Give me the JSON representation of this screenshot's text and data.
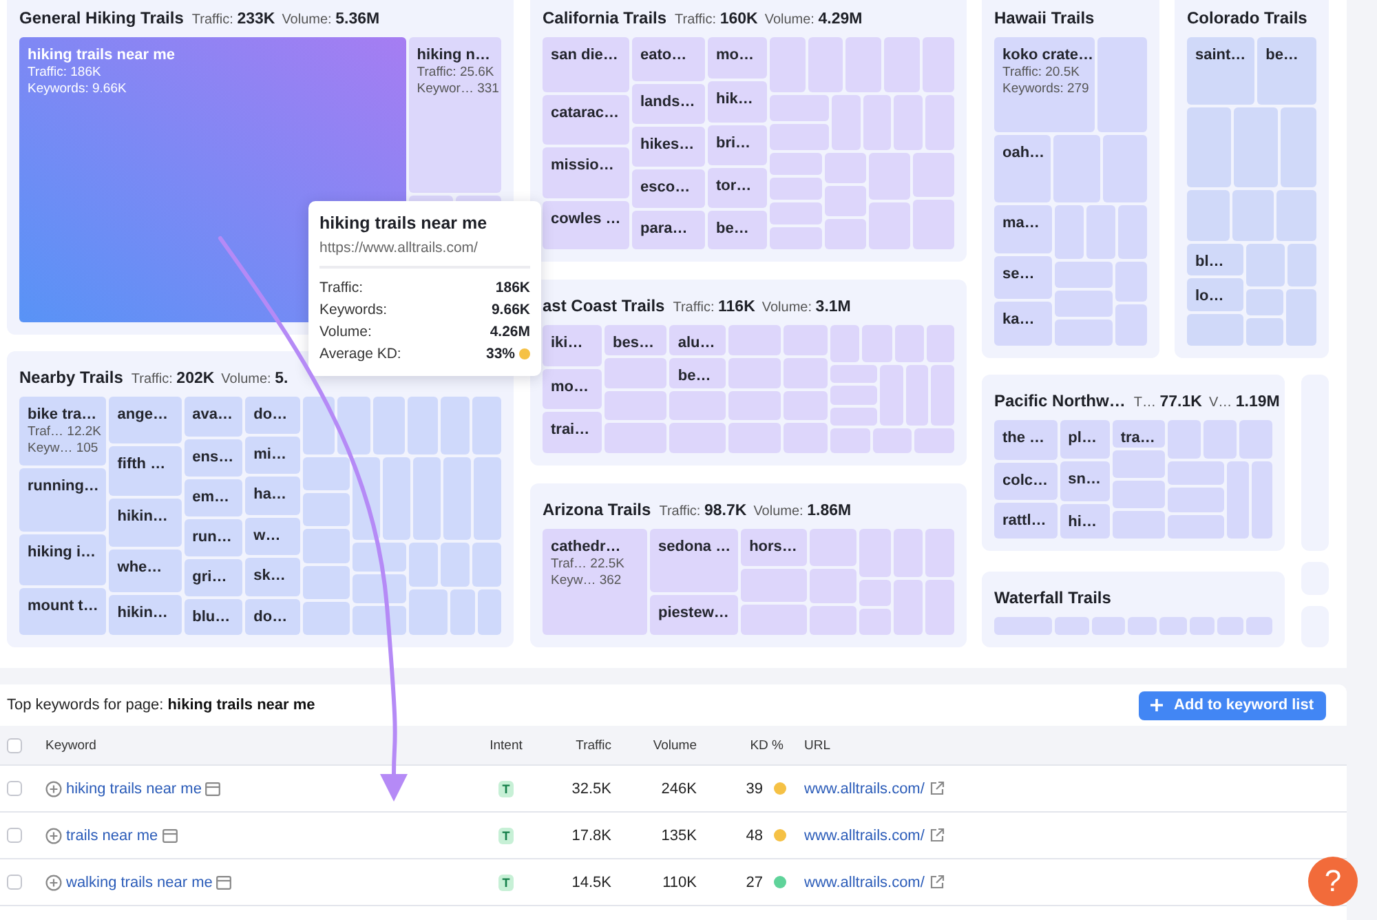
{
  "groups": [
    {
      "title": "General Hiking Trails",
      "traffic": "Traffic: **233K**",
      "volume": "Volume: **5.36M**",
      "tiles": [
        {
          "label": "hiking trails near me",
          "stats": [
            "Traffic: 186K",
            "Keywords: 9.66K"
          ],
          "selected": true
        },
        {
          "label": "hiking n…",
          "stats": [
            "Traffic: 25.6K",
            "Keywor… 331"
          ],
          "selected": false
        }
      ]
    },
    {
      "title": "Nearby Trails",
      "traffic": "Traffic: **202K**",
      "volume": "Volume: **5.**",
      "tiles": [
        {
          "label": "bike tra…",
          "stats": [
            "Traf… 12.2K",
            "Keyw… 105"
          ],
          "selected": false
        },
        {
          "label": "running…",
          "selected": false
        },
        {
          "label": "hiking i…",
          "selected": false
        },
        {
          "label": "mount t…",
          "selected": false
        },
        {
          "label": "ange…",
          "selected": false
        },
        {
          "label": "fifth …",
          "selected": false
        },
        {
          "label": "hikin…",
          "selected": false
        },
        {
          "label": "whe…",
          "selected": false
        },
        {
          "label": "hikin…",
          "selected": false
        },
        {
          "label": "ava…",
          "selected": false
        },
        {
          "label": "ens…",
          "selected": false
        },
        {
          "label": "em…",
          "selected": false
        },
        {
          "label": "run…",
          "selected": false
        },
        {
          "label": "gri…",
          "selected": false
        },
        {
          "label": "blu…",
          "selected": false
        },
        {
          "label": "do…",
          "selected": false
        },
        {
          "label": "mi…",
          "selected": false
        },
        {
          "label": "ha…",
          "selected": false
        },
        {
          "label": "w…",
          "selected": false
        },
        {
          "label": "sk…",
          "selected": false
        },
        {
          "label": "do…",
          "selected": false
        }
      ]
    },
    {
      "title": "California Trails",
      "traffic": "Traffic: **160K**",
      "volume": "Volume: **4.29M**",
      "tiles": [
        {
          "label": "san die…",
          "selected": false
        },
        {
          "label": "catarac…",
          "selected": false
        },
        {
          "label": "missio…",
          "selected": false
        },
        {
          "label": "cowles …",
          "selected": false
        },
        {
          "label": "eato…",
          "selected": false
        },
        {
          "label": "lands…",
          "selected": false
        },
        {
          "label": "hikes…",
          "selected": false
        },
        {
          "label": "esco…",
          "selected": false
        },
        {
          "label": "para…",
          "selected": false
        },
        {
          "label": "mo…",
          "selected": false
        },
        {
          "label": "hik…",
          "selected": false
        },
        {
          "label": "bri…",
          "selected": false
        },
        {
          "label": "tor…",
          "selected": false
        },
        {
          "label": "be…",
          "selected": false
        }
      ]
    },
    {
      "title": "ast Coast Trails",
      "traffic": "Traffic: **116K**",
      "volume": "Volume: **3.1M**",
      "tiles": [
        {
          "label": "iki…",
          "selected": false
        },
        {
          "label": "mo…",
          "selected": false
        },
        {
          "label": "trai…",
          "selected": false
        },
        {
          "label": "bes…",
          "selected": false
        },
        {
          "label": "alu…",
          "selected": false
        },
        {
          "label": "be…",
          "selected": false
        }
      ]
    },
    {
      "title": "Arizona Trails",
      "traffic": "Traffic: **98.7K**",
      "volume": "Volume: **1.86M**",
      "tiles": [
        {
          "label": "cathedr…",
          "stats": [
            "Traf… 22.5K",
            "Keyw… 362"
          ],
          "selected": false
        },
        {
          "label": "sedona …",
          "selected": false
        },
        {
          "label": "piestew…",
          "selected": false
        },
        {
          "label": "hors…",
          "selected": false
        }
      ]
    },
    {
      "title": "Hawaii Trails",
      "tiles": [
        {
          "label": "koko crate…",
          "stats": [
            "Traffic: 20.5K",
            "Keywords: 279"
          ],
          "selected": false
        },
        {
          "label": "oah…",
          "selected": false
        },
        {
          "label": "ma…",
          "selected": false
        },
        {
          "label": "se…",
          "selected": false
        },
        {
          "label": "ka…",
          "selected": false
        }
      ]
    },
    {
      "title": "Colorado Trails",
      "tiles": [
        {
          "label": "saint…",
          "selected": false
        },
        {
          "label": "be…",
          "selected": false
        },
        {
          "label": "bl…",
          "selected": false
        },
        {
          "label": "lo…",
          "selected": false
        }
      ]
    },
    {
      "title": "Pacific Northw…",
      "traffic": "T… **77.1K**",
      "volume": "V… **1.19M**",
      "tiles": [
        {
          "label": "the …",
          "selected": false
        },
        {
          "label": "colc…",
          "selected": false
        },
        {
          "label": "rattl…",
          "selected": false
        },
        {
          "label": "pl…",
          "selected": false
        },
        {
          "label": "sn…",
          "selected": false
        },
        {
          "label": "hi…",
          "selected": false
        },
        {
          "label": "tra…",
          "selected": false
        }
      ]
    },
    {
      "title": "Waterfall Trails"
    }
  ],
  "tooltip": {
    "title": "hiking trails near me",
    "url": "https://www.alltrails.com/",
    "rows": [
      {
        "label": "Traffic:",
        "value": "186K"
      },
      {
        "label": "Keywords:",
        "value": "9.66K"
      },
      {
        "label": "Volume:",
        "value": "4.26M"
      },
      {
        "label": "Average KD:",
        "value": "33%",
        "color": "#f5c145"
      }
    ]
  },
  "table": {
    "caption": "Top keywords for page: **hiking trails near me**",
    "button": "Add to keyword list",
    "select_all": {
      "checked": false
    },
    "columns": [
      "Keyword",
      "Intent",
      "Traffic",
      "Volume",
      "KD %",
      "URL"
    ],
    "rows": [
      {
        "checked": false,
        "keyword": "hiking trails near me",
        "intent": "T",
        "traffic": "32.5K",
        "volume": "246K",
        "kd": "39",
        "color": "#f5c145",
        "url": "www.alltrails.com/"
      },
      {
        "checked": false,
        "keyword": "trails near me",
        "intent": "T",
        "traffic": "17.8K",
        "volume": "135K",
        "kd": "48",
        "color": "#f5c145",
        "url": "www.alltrails.com/"
      },
      {
        "checked": false,
        "keyword": "walking trails near me",
        "intent": "T",
        "traffic": "14.5K",
        "volume": "110K",
        "kd": "27",
        "color": "#5fd39a",
        "url": "www.alltrails.com/"
      }
    ]
  },
  "help": {
    "label": "?"
  }
}
